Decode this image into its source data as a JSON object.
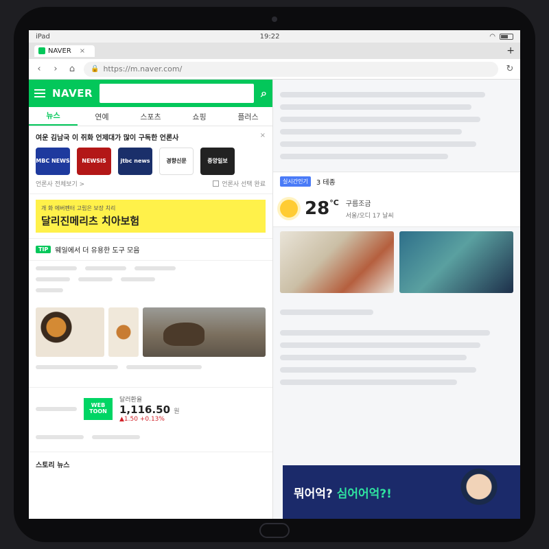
{
  "status": {
    "device": "iPad",
    "time": "19:22",
    "battery_level": 0.65
  },
  "browser": {
    "app_name": "NAVER",
    "tab": {
      "title": "NAVER"
    },
    "url": "https://m.naver.com/",
    "new_tab": "+"
  },
  "naver": {
    "logo": "NAVER",
    "nav_tabs": [
      "뉴스",
      "연예",
      "스포츠",
      "쇼핑",
      "플러스"
    ],
    "active_tab": 0,
    "press": {
      "title": "여운 김남국 이 쥐화 언제대가 많이 구독한 언론사",
      "logos": [
        {
          "label": "MBC NEWS",
          "color": "#1e3a9e"
        },
        {
          "label": "NEWSIS",
          "color": "#b31717"
        },
        {
          "label": "jtbc news",
          "color": "#1a2f6a"
        },
        {
          "label": "경향신문",
          "color": "#ffffff"
        },
        {
          "label": "중앙일보",
          "color": "#222222"
        }
      ],
      "more": "언론사 전체보기 >",
      "subscribe": "언론사 선택 완료"
    },
    "ad": {
      "sub": "개 화 에버펜터 고립은 보장 치리",
      "main": "달리진메리츠 치아보험"
    },
    "tip": {
      "badge": "TIP",
      "text": "웨일에서 더 유용한 도구 모음"
    },
    "exchange": {
      "webtoon": "WEB TOON",
      "label": "달러환율",
      "value": "1,116.50",
      "unit": "원",
      "change": "▲1.50 +0.13%"
    },
    "sub_news": "스토리 뉴스"
  },
  "weather": {
    "temp": "28",
    "unit": "°C",
    "condition": "구름조금",
    "location": "서울/오디 17 날씨"
  },
  "news": {
    "live_badge": "실시간인기",
    "live_text": "3 테종",
    "bottom_ad": {
      "main": "뭐어억?",
      "accent": "심어어억?!"
    }
  }
}
